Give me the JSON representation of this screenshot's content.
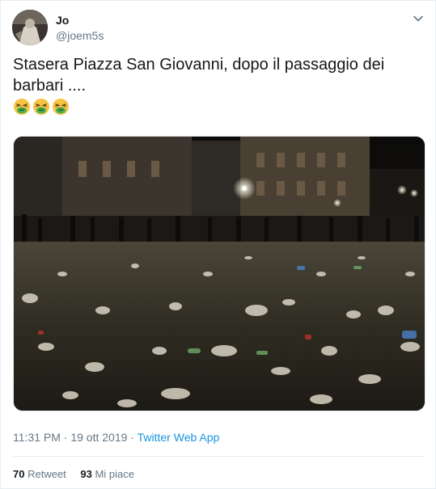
{
  "user": {
    "name": "Jo",
    "handle": "@joem5s"
  },
  "tweet": {
    "text": "Stasera Piazza San Giovanni, dopo il passaggio dei barbari ....",
    "emojis": [
      "nauseated-face",
      "nauseated-face",
      "nauseated-face"
    ],
    "time": "11:31 PM",
    "date": "19 ott 2019",
    "separator": "·",
    "source": "Twitter Web App"
  },
  "stats": {
    "retweets_count": "70",
    "retweets_label": "Retweet",
    "likes_count": "93",
    "likes_label": "Mi piace"
  },
  "colors": {
    "link": "#1b95e0",
    "muted": "#657786",
    "text": "#14171a",
    "border": "#e6ecf0"
  }
}
